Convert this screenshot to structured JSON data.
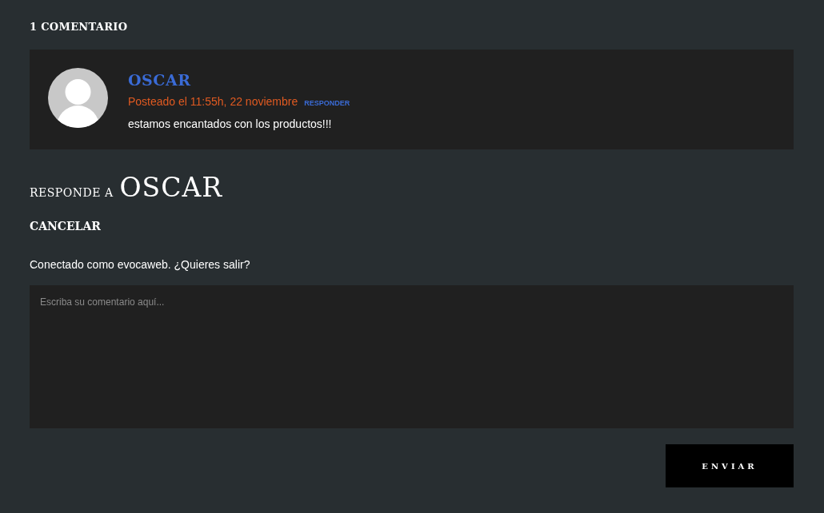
{
  "comments_heading": "1 COMENTARIO",
  "comments": [
    {
      "author": "OSCAR",
      "meta": "Posteado el 11:55h, 22 noviembre",
      "reply_link": "RESPONDER",
      "text": "estamos encantados con los productos!!!"
    }
  ],
  "reply_form": {
    "title_prefix": "RESPONDE A",
    "title_name": "OSCAR",
    "cancel": "CANCELAR",
    "logged_in": "Conectado como evocaweb. ¿Quieres salir?",
    "placeholder": "Escriba su comentario aquí...",
    "submit": "ENVIAR"
  }
}
